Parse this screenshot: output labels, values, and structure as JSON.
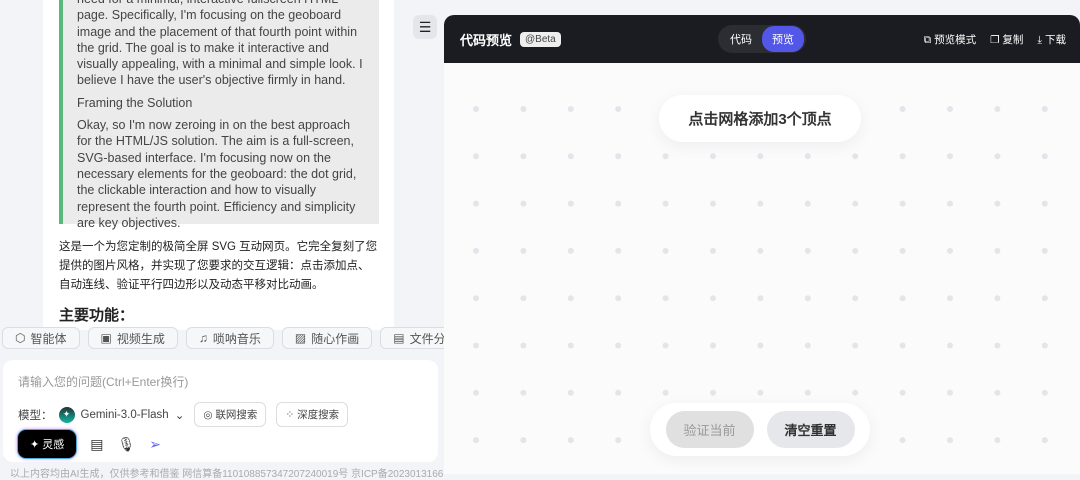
{
  "chat": {
    "quote_paragraphs": [
      "need for a minimal, interactive fullscreen HTML page. Specifically, I'm focusing on the geoboard image and the placement of that fourth point within the grid. The goal is to make it interactive and visually appealing, with a minimal and simple look. I believe I have the user's objective firmly in hand.",
      "Framing the Solution",
      "Okay, so I'm now zeroing in on the best approach for the HTML/JS solution. The aim is a full-screen, SVG-based interface. I'm focusing now on the necessary elements for the geoboard: the dot grid, the clickable interaction and how to visually represent the fourth point. Efficiency and simplicity are key objectives."
    ],
    "answer": "这是一个为您定制的极简全屏 SVG 互动网页。它完全复刻了您提供的图片风格，并实现了您要求的交互逻辑：点击添加点、自动连线、验证平行四边形以及动态平移对比动画。",
    "subhead": "主要功能："
  },
  "tools": [
    {
      "label": "智能体",
      "icon": "agent-icon",
      "glyph": "⬡"
    },
    {
      "label": "视频生成",
      "icon": "video-icon",
      "glyph": "▣"
    },
    {
      "label": "唢呐音乐",
      "icon": "music-icon",
      "glyph": "♫"
    },
    {
      "label": "随心作画",
      "icon": "image-icon",
      "glyph": "▨"
    },
    {
      "label": "文件分析",
      "icon": "file-icon",
      "glyph": "▤"
    }
  ],
  "input": {
    "placeholder": "请输入您的问题(Ctrl+Enter换行)",
    "model_label": "模型：",
    "model": "Gemini-3.0-Flash",
    "web_search": "联网搜索",
    "deep_search": "深度搜索",
    "inspiration": "灵感"
  },
  "footer": "以上内容均由AI生成，仅供参考和借鉴 网信算备110108857347207240019号 京ICP备2023013166",
  "preview": {
    "title": "代码预览",
    "badge": "@Beta",
    "tabs": [
      "代码",
      "预览"
    ],
    "active_tab": "预览",
    "actions": [
      "预览模式",
      "复制",
      "下载"
    ],
    "prompt": "点击网格添加3个顶点",
    "verify": "验证当前",
    "reset": "清空重置",
    "grid": {
      "cols": 13,
      "rows": 8
    }
  }
}
